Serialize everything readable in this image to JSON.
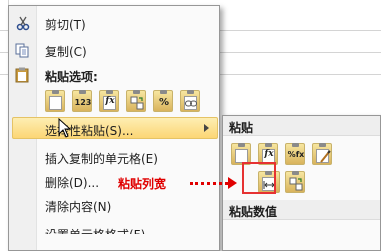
{
  "menu": {
    "items": [
      {
        "label": "剪切(T)",
        "icon": "scissors-icon"
      },
      {
        "label": "复制(C)",
        "icon": "copy-icon"
      },
      {
        "label": "选择性粘贴(S)...",
        "icon": "paste-special-icon"
      },
      {
        "label": "插入复制的单元格(E)",
        "icon": ""
      },
      {
        "label": "删除(D)...",
        "icon": ""
      },
      {
        "label": "清除内容(N)",
        "icon": ""
      },
      {
        "label": "设置单元格格式(F)...",
        "icon": ""
      }
    ],
    "paste_options_header": "粘贴选项:",
    "paste_options": [
      "",
      "123",
      "fx",
      "",
      "%",
      ""
    ]
  },
  "submenu": {
    "paste_header": "粘贴",
    "paste_buttons": [
      "",
      "fx",
      "%fx",
      ""
    ],
    "paste_values_header": "粘贴数值"
  },
  "annotation": {
    "callout": "粘贴列宽",
    "color": "#e00000"
  }
}
